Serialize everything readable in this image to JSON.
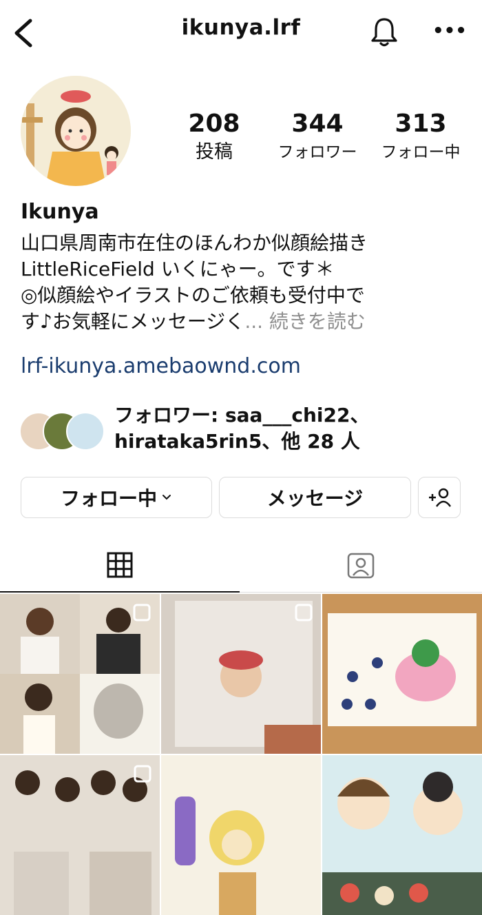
{
  "header": {
    "username": "ikunya.lrf"
  },
  "stats": {
    "posts": {
      "value": "208",
      "label": "投稿"
    },
    "followers": {
      "value": "344",
      "label": "フォロワー"
    },
    "following": {
      "value": "313",
      "label": "フォロー中"
    }
  },
  "profile": {
    "name": "Ikunya",
    "bio_line1": "山口県周南市在住のほんわか似顔絵描き",
    "bio_line2": "LittleRiceField いくにゃー。です＊",
    "bio_line3": "◎似顔絵やイラストのご依頼も受付中で",
    "bio_line4": "す♪お気軽にメッセージく",
    "bio_ellipsis": "...",
    "bio_more": "続きを読む",
    "link": "lrf-ikunya.amebaownd.com"
  },
  "followed_by": {
    "line1": "フォロワー: saa___chi22、",
    "line2": "hirataka5rin5、他 28 人"
  },
  "actions": {
    "follow_label": "フォロー中",
    "message_label": "メッセージ"
  },
  "colors": {
    "link": "#1a3c6e",
    "muted": "#8e8e8e",
    "border": "#dbdbdb"
  }
}
